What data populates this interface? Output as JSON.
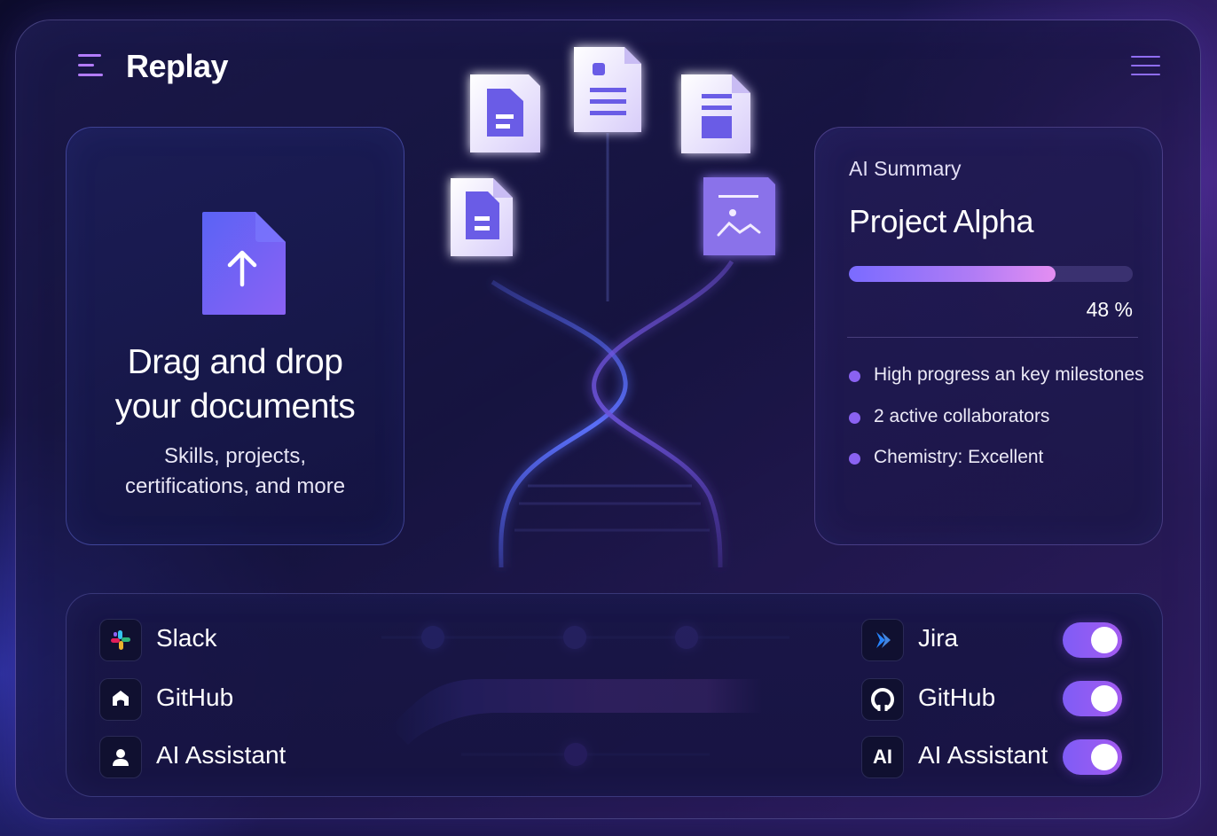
{
  "app": {
    "title": "Replay"
  },
  "upload": {
    "title_line1": "Drag and drop",
    "title_line2": "your documents",
    "subtitle_line1": "Skills, projects,",
    "subtitle_line2": "certifications, and more"
  },
  "summary": {
    "label": "AI Summary",
    "project": "Project Alpha",
    "progress_percent": 48,
    "progress_text": "48 %",
    "bullets": [
      "High progress an key milestones",
      "2 active collaborators",
      "Chemistry: Excellent"
    ]
  },
  "integrations": {
    "left": [
      {
        "label": "Slack",
        "icon": "slack-icon"
      },
      {
        "label": "GitHub",
        "icon": "github-icon"
      },
      {
        "label": "AI Assistant",
        "icon": "user-icon"
      }
    ],
    "right": [
      {
        "label": "Jira",
        "icon": "jira-icon",
        "enabled": true
      },
      {
        "label": "GitHub",
        "icon": "github-icon",
        "enabled": true
      },
      {
        "label": "AI Assistant",
        "icon": "ai-icon",
        "icon_text": "AI",
        "enabled": true
      }
    ]
  },
  "colors": {
    "accent": "#8a62f2",
    "background": "#171445",
    "toggle_on": "#8f5cf4"
  }
}
